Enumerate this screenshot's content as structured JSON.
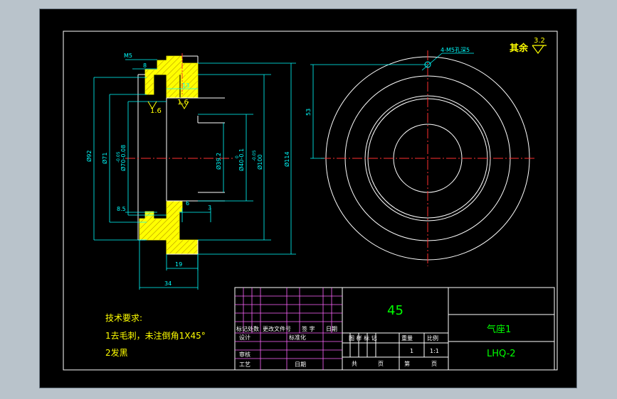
{
  "roughness": {
    "label": "其余",
    "value": "3.2"
  },
  "section_view": {
    "dims": {
      "phi5": "M5",
      "eight": "8",
      "thirteen": "13",
      "rough1": "1.6",
      "rough2": "1.6",
      "d92": "Ø92",
      "d71": "Ø71",
      "d70": "Ø70-0.08",
      "d70_tol": "-0.05",
      "d39": "Ø39.2",
      "d40": "Ø40-0.1",
      "d40_tol": "0",
      "d100": "Ø100",
      "d100_tol": "-0.05",
      "d114": "Ø114",
      "eight5": "8.5",
      "six": "6",
      "three": "3",
      "nineteen": "19",
      "thirtyfour": "34"
    }
  },
  "front_view": {
    "hole_note": "4-M5孔深5",
    "dim_53": "53"
  },
  "tech_requirements": {
    "title": "技术要求:",
    "line1": "1去毛刺，未注倒角1X45°",
    "line2": "2发黑"
  },
  "title_block": {
    "material": "45",
    "part_name": "气座1",
    "drawing_no": "LHQ-2",
    "row_labels": [
      "标记",
      "处数",
      "更改文件号",
      "签 字",
      "日期"
    ],
    "design": "设计",
    "standardize": "标准化",
    "review": "审核",
    "process": "工艺",
    "date": "日期",
    "stage_mark": "图 样 标 记",
    "weight": "重量",
    "scale": "比例",
    "weight_val": "1",
    "scale_val": "1:1",
    "total": "共",
    "sheet": "页",
    "no": "第",
    "sheet2": "页"
  }
}
